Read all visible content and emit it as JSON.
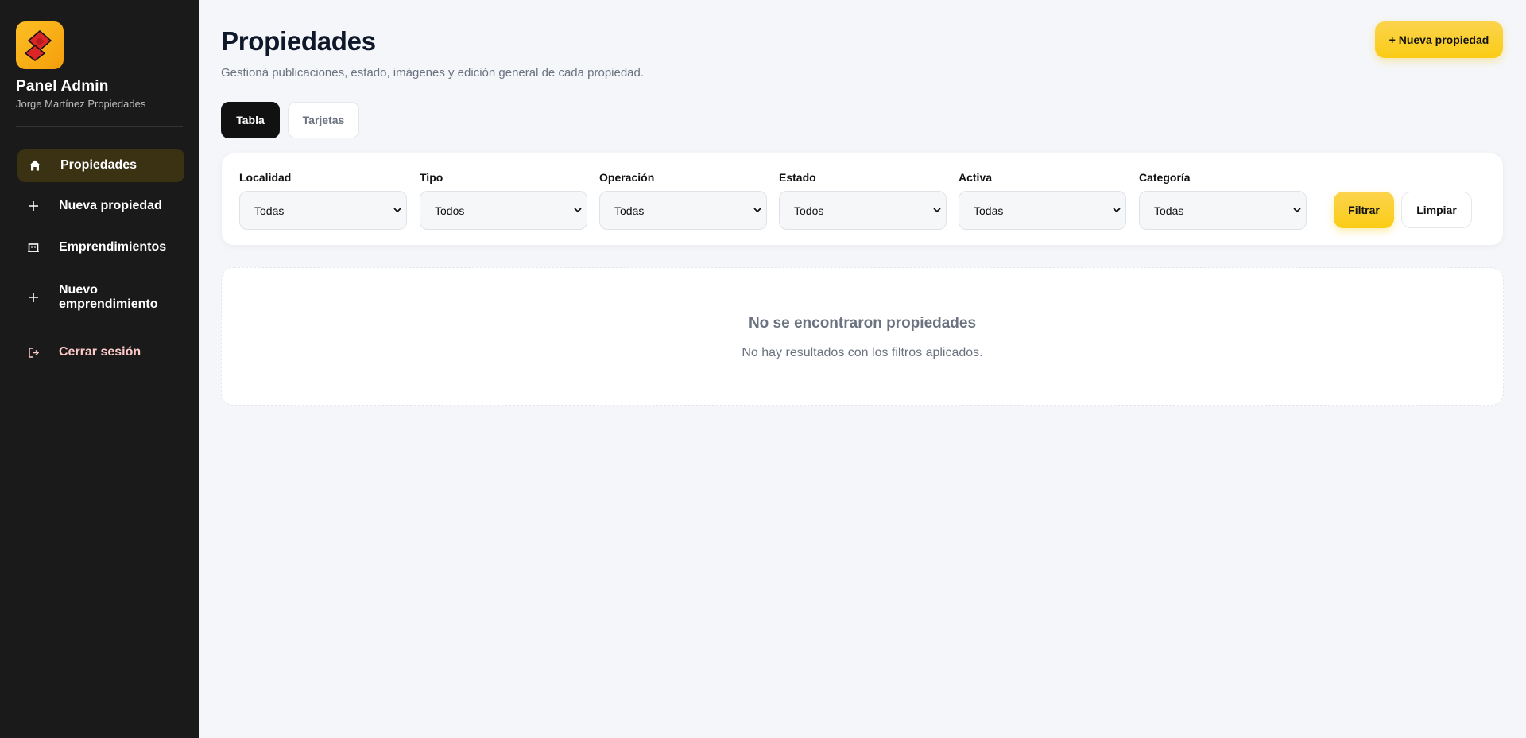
{
  "sidebar": {
    "brand_title": "Panel Admin",
    "brand_subtitle": "Jorge Martínez Propiedades",
    "items": [
      {
        "label": "Propiedades",
        "icon": "home-icon",
        "active": true
      },
      {
        "label": "Nueva propiedad",
        "icon": "plus-icon"
      },
      {
        "label": "Emprendimientos",
        "icon": "building-icon"
      },
      {
        "label": "Nuevo emprendimiento",
        "icon": "plus-icon"
      },
      {
        "label": "Cerrar sesión",
        "icon": "logout-icon"
      }
    ]
  },
  "header": {
    "title": "Propiedades",
    "subtitle": "Gestioná publicaciones, estado, imágenes y edición general de cada propiedad.",
    "new_button_label": "+ Nueva propiedad"
  },
  "view_tabs": {
    "tabla": "Tabla",
    "tarjetas": "Tarjetas",
    "active": "Tabla"
  },
  "filters": {
    "fields": [
      {
        "label": "Localidad",
        "value": "Todas"
      },
      {
        "label": "Tipo",
        "value": "Todos"
      },
      {
        "label": "Operación",
        "value": "Todas"
      },
      {
        "label": "Estado",
        "value": "Todos"
      },
      {
        "label": "Activa",
        "value": "Todas"
      },
      {
        "label": "Categoría",
        "value": "Todas"
      }
    ],
    "filter_button": "Filtrar",
    "clear_button": "Limpiar"
  },
  "empty_state": {
    "title": "No se encontraron propiedades",
    "message": "No hay resultados con los filtros aplicados."
  },
  "colors": {
    "sidebar_bg": "#1a1a1a",
    "accent": "#facc15",
    "logo_bg": "#f59e0b",
    "logo_mark": "#dc2626",
    "page_bg": "#f4f6f9"
  }
}
